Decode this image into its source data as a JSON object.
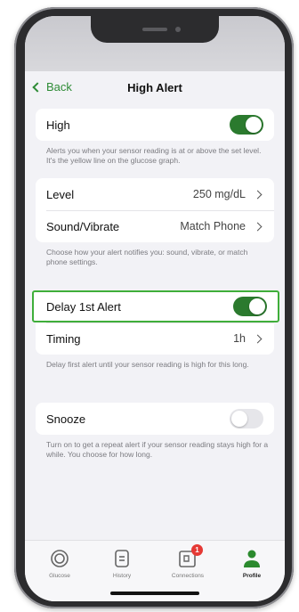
{
  "nav": {
    "back_label": "Back",
    "title": "High Alert"
  },
  "high": {
    "label": "High",
    "enabled": true,
    "note": "Alerts you when your sensor reading is at or above the set level. It's the yellow line on the glucose graph."
  },
  "level": {
    "label": "Level",
    "value": "250 mg/dL"
  },
  "sound": {
    "label": "Sound/Vibrate",
    "value": "Match Phone",
    "note": "Choose how your alert notifies you: sound, vibrate, or match phone settings."
  },
  "delay": {
    "label": "Delay 1st Alert",
    "enabled": true
  },
  "timing": {
    "label": "Timing",
    "value": "1h",
    "note": "Delay first alert until your sensor reading is high for this long."
  },
  "snooze": {
    "label": "Snooze",
    "enabled": false,
    "note": "Turn on to get a repeat alert if your sensor reading stays high for a while. You choose for how long."
  },
  "tabs": [
    {
      "label": "Glucose",
      "icon": "glucose-icon"
    },
    {
      "label": "History",
      "icon": "history-icon"
    },
    {
      "label": "Connections",
      "icon": "connections-icon",
      "badge": "1"
    },
    {
      "label": "Profile",
      "icon": "profile-icon",
      "active": true
    }
  ],
  "colors": {
    "accent": "#2b7a2e",
    "highlight": "#3fae3a",
    "badge": "#e53935"
  }
}
